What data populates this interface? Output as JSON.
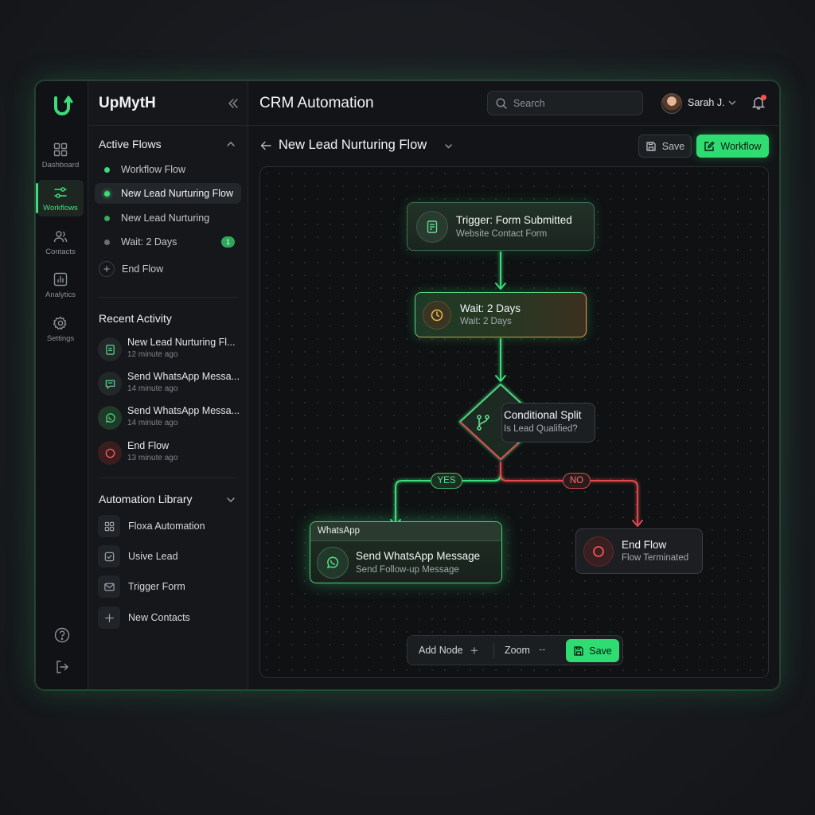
{
  "app": {
    "brand": "UpMytH",
    "page_title": "CRM Automation"
  },
  "colors": {
    "accent": "#2fdc72",
    "danger": "#e0484c",
    "warning": "#e6a03c"
  },
  "rail": {
    "items": [
      {
        "label": "Dashboard",
        "icon": "grid-icon"
      },
      {
        "label": "Workflows",
        "icon": "sliders-icon",
        "active": true
      },
      {
        "label": "Contacts",
        "icon": "users-icon"
      },
      {
        "label": "Analytics",
        "icon": "chart-icon"
      },
      {
        "label": "Settings",
        "icon": "gear-icon"
      }
    ],
    "bottom": [
      "help-icon",
      "logout-icon"
    ]
  },
  "sidebar": {
    "active_flows": {
      "title": "Active Flows",
      "items": [
        {
          "label": "Workflow Flow"
        },
        {
          "label": "New Lead Nurturing Flow",
          "active": true
        },
        {
          "label": "New Lead Nurturing"
        },
        {
          "label": "Wait: 2 Days",
          "badge": "1"
        },
        {
          "label": "End Flow"
        }
      ]
    },
    "recent_activity": {
      "title": "Recent Activity",
      "items": [
        {
          "title": "New Lead Nurturing Fl...",
          "time": "12 minute ago"
        },
        {
          "title": "Send WhatsApp Messa...",
          "time": "14 minute ago"
        },
        {
          "title": "Send WhatsApp Messa...",
          "time": "14 minute ago"
        },
        {
          "title": "End Flow",
          "time": "13 minute ago"
        }
      ]
    },
    "library": {
      "title": "Automation Library",
      "items": [
        {
          "label": "Floxa Automation"
        },
        {
          "label": "Usive Lead"
        },
        {
          "label": "Trigger Form"
        },
        {
          "label": "New Contacts"
        }
      ]
    }
  },
  "header": {
    "search_placeholder": "Search",
    "user_name": "Sarah J."
  },
  "flow": {
    "title": "New Lead Nurturing Flow",
    "save_label": "Save",
    "workflow_label": "Workflow"
  },
  "canvas": {
    "trigger": {
      "title": "Trigger: Form Submitted",
      "subtitle": "Website Contact Form"
    },
    "wait": {
      "title": "Wait: 2 Days",
      "subtitle": "Wait: 2 Days"
    },
    "split": {
      "title": "Conditional Split",
      "subtitle": "Is Lead Qualified?"
    },
    "yes_label": "YES",
    "no_label": "NO",
    "whatsapp": {
      "header": "WhatsApp",
      "title": "Send WhatsApp Message",
      "subtitle": "Send Follow-up Message"
    },
    "end": {
      "title": "End Flow",
      "subtitle": "Flow Terminated"
    },
    "toolbar": {
      "add_node": "Add Node",
      "zoom": "Zoom",
      "zoom_value": "--",
      "save": "Save"
    }
  }
}
